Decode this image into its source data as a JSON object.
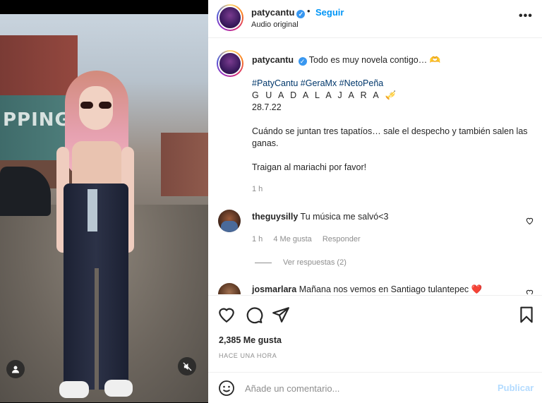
{
  "media": {
    "container_text": "PPING"
  },
  "header": {
    "username": "patycantu",
    "verified_mark": "✓",
    "separator": "•",
    "follow_label": "Seguir",
    "subtitle": "Audio original",
    "more_label": "•••"
  },
  "caption": {
    "username": "patycantu",
    "verified_mark": "✓",
    "text": "Todo es muy novela contigo… 🫶",
    "hashtags": "#PatyCantu #GeraMx #NetoPeña",
    "city": "G U A D A L A J A R A 🎺",
    "date": "28.7.22",
    "paragraph1": "Cuándo se juntan tres tapatíos… sale el despecho y también salen las ganas.",
    "paragraph2": "Traigan al mariachi por favor!",
    "time": "1 h"
  },
  "comments": [
    {
      "username": "theguysilly",
      "text": "Tu música me salvó<3",
      "time": "1 h",
      "likes": "4 Me gusta",
      "reply_label": "Responder",
      "view_replies": "Ver respuestas (2)"
    },
    {
      "username": "josmarlara",
      "text": "Mañana nos vemos en Santiago tulantepec ❤️"
    }
  ],
  "actions": {
    "likes": "2,385 Me gusta",
    "time_ago": "HACE UNA HORA"
  },
  "add_comment": {
    "placeholder": "Añade un comentario...",
    "post_label": "Publicar"
  },
  "icons": [
    "heart-icon",
    "comment-icon",
    "share-icon",
    "bookmark-icon",
    "emoji-icon",
    "user-tag-icon",
    "mute-icon",
    "more-icon"
  ]
}
